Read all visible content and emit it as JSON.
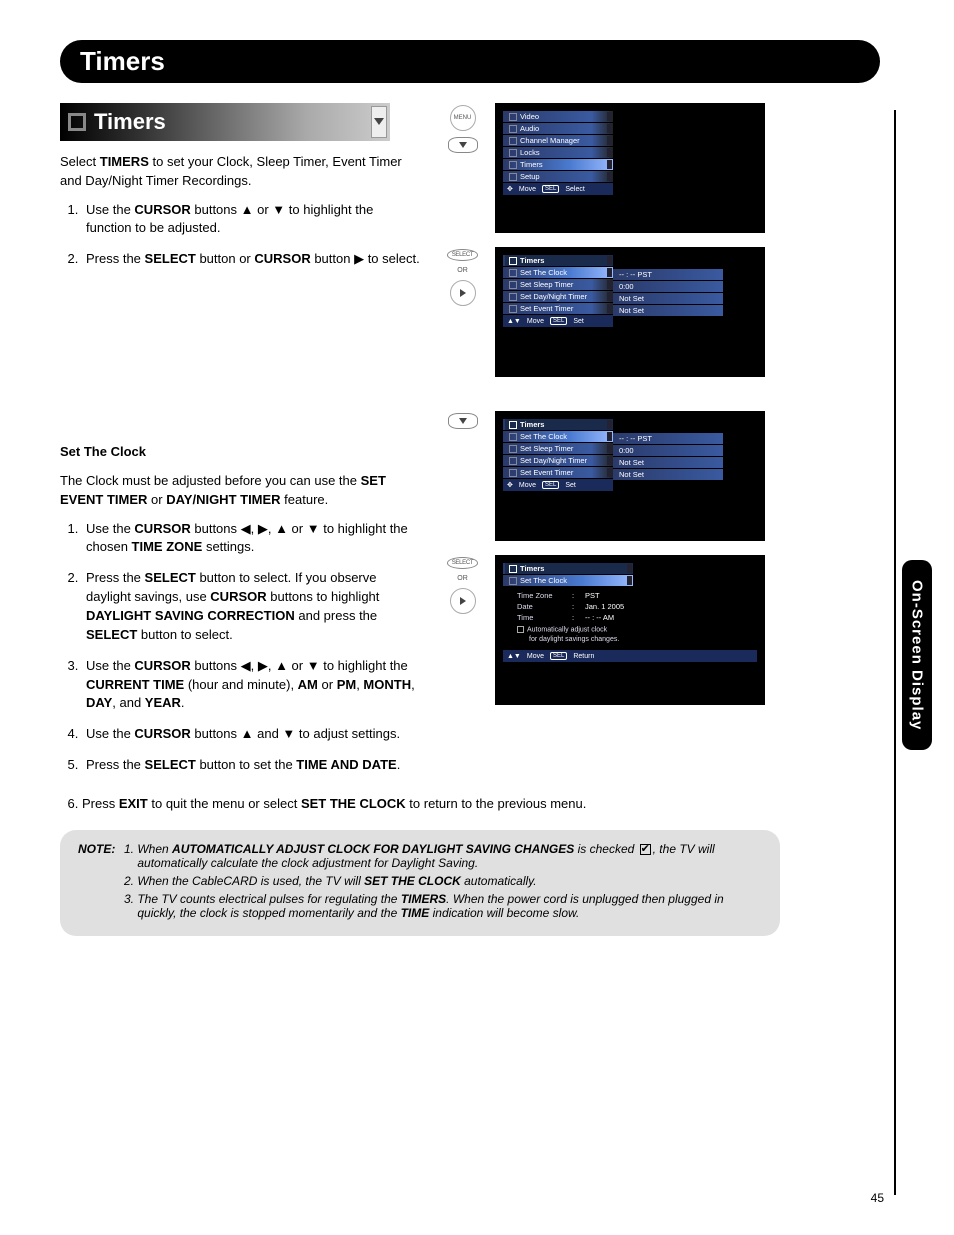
{
  "page_number": "45",
  "side_tab": "On-Screen Display",
  "title_bar": "Timers",
  "sub_bar": "Timers",
  "intro": {
    "line1_pre": "Select ",
    "line1_b": "TIMERS",
    "line1_post": " to set your Clock, Sleep Timer, Event Timer and Day/Night Timer Recordings."
  },
  "steps_a": {
    "s1_pre": "Use the ",
    "s1_b1": "CURSOR",
    "s1_mid": " buttons ▲ or ▼ to highlight the function to be adjusted.",
    "s2_pre": "Press the ",
    "s2_b1": "SELECT",
    "s2_mid": " button or ",
    "s2_b2": "CURSOR",
    "s2_post": " button ▶ to select."
  },
  "set_clock_head": "Set The Clock",
  "set_clock_intro_pre": "The Clock must be adjusted before you can use the ",
  "set_clock_intro_b1": "SET EVENT TIMER",
  "set_clock_intro_mid": " or ",
  "set_clock_intro_b2": "DAY/NIGHT TIMER",
  "set_clock_intro_post": " feature.",
  "steps_b": {
    "s1_pre": "Use the ",
    "s1_b1": "CURSOR",
    "s1_mid": " buttons ◀, ▶, ▲ or ▼ to highlight the chosen ",
    "s1_b2": "TIME ZONE",
    "s1_post": " settings.",
    "s2_pre": "Press the ",
    "s2_b1": "SELECT",
    "s2_mid": " button to select. If you observe daylight savings, use ",
    "s2_b2": "CURSOR",
    "s2_mid2": " buttons to highlight ",
    "s2_b3": "DAYLIGHT SAVING CORRECTION",
    "s2_mid3": " and press the ",
    "s2_b4": "SELECT",
    "s2_post": " button to select.",
    "s3_pre": "Use the ",
    "s3_b1": "CURSOR",
    "s3_mid": " buttons ◀, ▶, ▲ or ▼ to highlight the ",
    "s3_b2": "CURRENT TIME",
    "s3_mid2": " (hour and minute), ",
    "s3_b3": "AM",
    "s3_mid3": " or ",
    "s3_b4": "PM",
    "s3_mid4": ", ",
    "s3_b5": "MONTH",
    "s3_mid5": ", ",
    "s3_b6": "DAY",
    "s3_mid6": ", and ",
    "s3_b7": "YEAR",
    "s3_post": ".",
    "s4_pre": "Use the ",
    "s4_b1": "CURSOR",
    "s4_post": " buttons ▲ and ▼ to adjust settings.",
    "s5_pre": "Press the ",
    "s5_b1": "SELECT",
    "s5_mid": " button to set the ",
    "s5_b2": "TIME AND DATE",
    "s5_post": ".",
    "s6_pre": "Press ",
    "s6_b1": "EXIT",
    "s6_mid": " to quit the menu or select ",
    "s6_b2": "SET THE CLOCK",
    "s6_post": " to return to the previous menu."
  },
  "note": {
    "label": "NOTE:",
    "n1_pre": "When ",
    "n1_b1": "AUTOMATICALLY ADJUST CLOCK FOR DAYLIGHT SAVING CHANGES",
    "n1_mid": " is checked ",
    "n1_post": ", the TV will automatically calculate the clock adjustment for Daylight Saving.",
    "n2_pre": "When the CableCARD is used, the TV will ",
    "n2_b1": "SET THE CLOCK",
    "n2_post": " automatically.",
    "n3_pre": "The TV counts electrical pulses for regulating the ",
    "n3_b1": "TIMERS",
    "n3_mid": ". When the power cord is unplugged then plugged in quickly, the clock is stopped momentarily and the ",
    "n3_b2": "TIME",
    "n3_post": " indication will become slow."
  },
  "osd1": {
    "remote_label": "MENU",
    "menu": [
      "Video",
      "Audio",
      "Channel Manager",
      "Locks",
      "Timers",
      "Setup"
    ],
    "hint_move": "Move",
    "hint_sel": "SEL",
    "hint_select": "Select"
  },
  "osd2": {
    "remote_label": "SELECT",
    "or": "OR",
    "head": "Timers",
    "items": [
      "Set The Clock",
      "Set Sleep Timer",
      "Set Day/Night Timer",
      "Set Event Timer"
    ],
    "vals": [
      "-- : --  PST",
      "0:00",
      "Not Set",
      "Not Set"
    ],
    "hint_move": "Move",
    "hint_sel": "SEL",
    "hint_set": "Set"
  },
  "osd3": {
    "head": "Timers",
    "items": [
      "Set The Clock",
      "Set Sleep Timer",
      "Set Day/Night Timer",
      "Set Event Timer"
    ],
    "vals": [
      "-- : --  PST",
      "0:00",
      "Not Set",
      "Not Set"
    ],
    "hint_move": "Move",
    "hint_sel": "SEL",
    "hint_set": "Set"
  },
  "osd4": {
    "remote_label": "SELECT",
    "or": "OR",
    "head": "Timers",
    "sub": "Set The Clock",
    "rows": [
      {
        "lbl": "Time Zone",
        "val": "PST"
      },
      {
        "lbl": "Date",
        "val": "Jan. 1 2005"
      },
      {
        "lbl": "Time",
        "val": "-- : -- AM"
      }
    ],
    "auto1": "Automatically adjust clock",
    "auto2": "for daylight savings changes.",
    "hint_move": "Move",
    "hint_sel": "SEL",
    "hint_ret": "Return"
  }
}
